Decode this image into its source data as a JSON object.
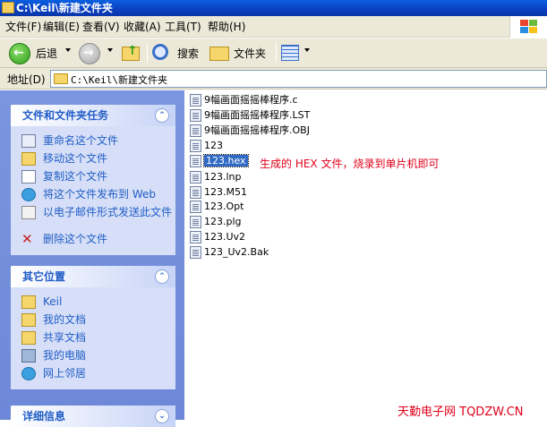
{
  "window": {
    "title": "C:\\Keil\\新建文件夹"
  },
  "menu": [
    "文件(F)",
    "编辑(E)",
    "查看(V)",
    "收藏(A)",
    "工具(T)",
    "帮助(H)"
  ],
  "toolbar": {
    "back_label": "后退",
    "search_label": "搜索",
    "folders_label": "文件夹"
  },
  "address": {
    "label": "地址(D)",
    "value": "C:\\Keil\\新建文件夹"
  },
  "tasks_panel": {
    "title": "文件和文件夹任务",
    "items": [
      "重命名这个文件",
      "移动这个文件",
      "复制这个文件",
      "将这个文件发布到 Web",
      "以电子邮件形式发送此文件",
      "删除这个文件"
    ]
  },
  "places_panel": {
    "title": "其它位置",
    "items": [
      "Keil",
      "我的文档",
      "共享文档",
      "我的电脑",
      "网上邻居"
    ]
  },
  "details_panel": {
    "title": "详细信息"
  },
  "files": [
    "9幅画面摇摇棒程序.c",
    "9幅画面摇摇棒程序.LST",
    "9幅画面摇摇棒程序.OBJ",
    "123",
    "123.hex",
    "123.lnp",
    "123.M51",
    "123.Opt",
    "123.plg",
    "123.Uv2",
    "123_Uv2.Bak"
  ],
  "selected_file": "123.hex",
  "annotation": "生成的 HEX 文件，烧录到单片机即可",
  "watermark": "天勤电子网 TQDZW.CN",
  "colors": {
    "link_blue": "#215dc6",
    "annotation_red": "#e0001a",
    "selection": "#316ac5"
  }
}
